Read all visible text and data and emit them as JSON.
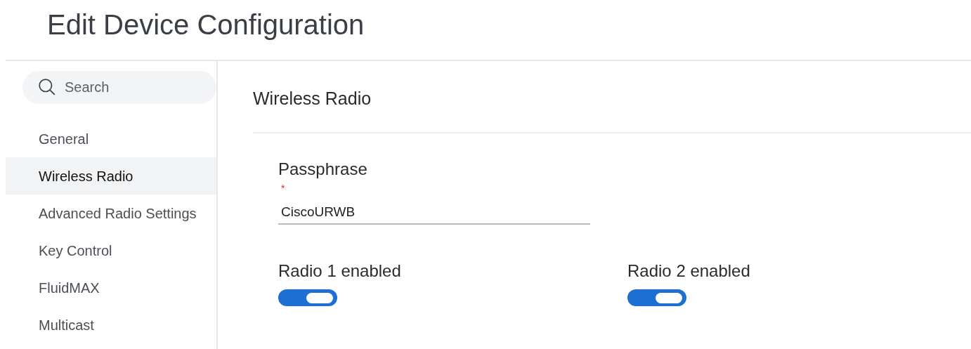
{
  "page": {
    "title": "Edit Device Configuration"
  },
  "sidebar": {
    "search": {
      "placeholder": "Search"
    },
    "items": [
      {
        "label": "General",
        "selected": false
      },
      {
        "label": "Wireless Radio",
        "selected": true
      },
      {
        "label": "Advanced Radio Settings",
        "selected": false
      },
      {
        "label": "Key Control",
        "selected": false
      },
      {
        "label": "FluidMAX",
        "selected": false
      },
      {
        "label": "Multicast",
        "selected": false
      }
    ]
  },
  "main": {
    "section_title": "Wireless Radio",
    "passphrase": {
      "label": "Passphrase",
      "required_mark": "*",
      "value": "CiscoURWB"
    },
    "radios": [
      {
        "label": "Radio 1 enabled",
        "on": true
      },
      {
        "label": "Radio 2 enabled",
        "on": true
      }
    ]
  }
}
